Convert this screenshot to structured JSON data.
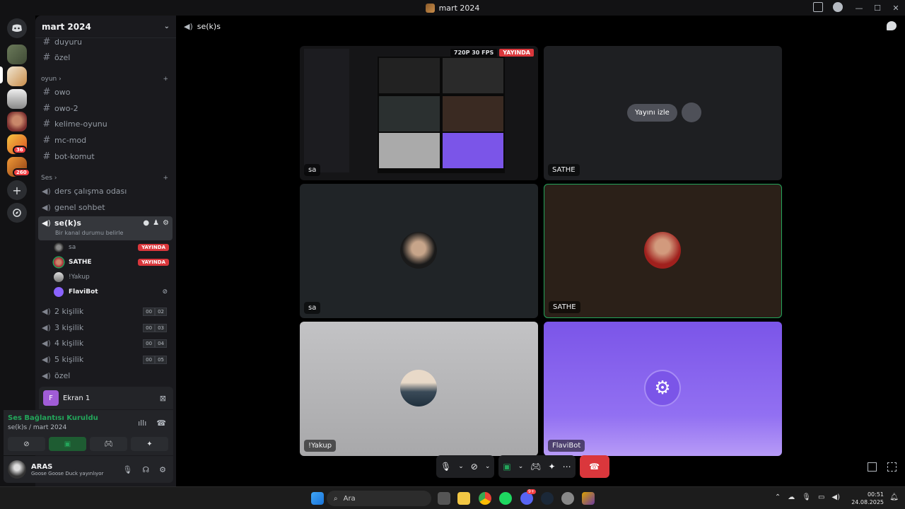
{
  "window": {
    "title": "mart 2024",
    "controls": [
      "—",
      "☐",
      "✕"
    ]
  },
  "server": {
    "name": "mart 2024"
  },
  "channels": {
    "top": [
      "duyuru",
      "özel"
    ],
    "cat_oyun": "oyun",
    "oyun": [
      "owo",
      "owo-2",
      "kelime-oyunu",
      "mc-mod",
      "bot-komut"
    ],
    "cat_ses": "Ses",
    "voice": [
      "ders çalışma odası",
      "genel sohbet"
    ],
    "active": {
      "name": "se(k)s",
      "status": "Bir kanal durumu belirle"
    },
    "voice_users": [
      {
        "name": "sa",
        "live": "YAYINDA"
      },
      {
        "name": "SATHE",
        "live": "YAYINDA"
      },
      {
        "name": "!Yakup"
      },
      {
        "name": "FlaviBot"
      }
    ],
    "more_voice": [
      {
        "name": "2 kişilik",
        "a": "00",
        "b": "02"
      },
      {
        "name": "3 kişilik",
        "a": "00",
        "b": "03"
      },
      {
        "name": "4 kişilik",
        "a": "00",
        "b": "04"
      },
      {
        "name": "5 kişilik",
        "a": "00",
        "b": "05"
      }
    ],
    "last": "özel"
  },
  "rail_badges": [
    "36",
    "260"
  ],
  "screen_panel": {
    "icon_letter": "F",
    "label": "Ekran 1"
  },
  "voice_panel": {
    "status": "Ses Bağlantısı Kuruldu",
    "location": "se(k)s / mart 2024"
  },
  "user": {
    "name": "ARAS",
    "status": "Goose Goose Duck yayınlıyor"
  },
  "main": {
    "channel": "se(k)s",
    "stream_quality": "720P 30 FPS",
    "stream_live": "YAYINDA",
    "watch_label": "Yayını izle",
    "tiles": [
      "sa",
      "SATHE",
      "sa",
      "SATHE",
      "!Yakup",
      "FlaviBot"
    ]
  },
  "taskbar": {
    "search": "Ara",
    "time": "00:51",
    "date": "24.08.2025",
    "discord_badge": "9+"
  }
}
